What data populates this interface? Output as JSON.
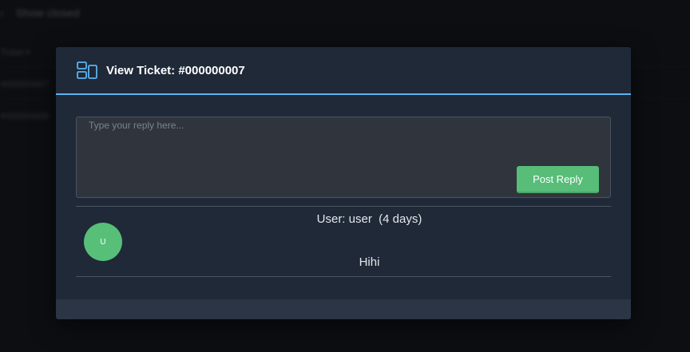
{
  "background": {
    "back_label": "Show closed",
    "rows": [
      "Ticket #",
      "#000000007",
      "#000000008"
    ]
  },
  "modal": {
    "title": "View Ticket: #000000007",
    "reply": {
      "placeholder": "Type your reply here...",
      "value": ""
    },
    "post_reply_label": "Post Reply",
    "messages": [
      {
        "avatar_initial": "U",
        "author": "User: user",
        "time": "(4 days)",
        "body": "Hihi"
      }
    ]
  },
  "colors": {
    "accent": "#5ab4f0",
    "button": "#57bd78",
    "avatar": "#58bf78",
    "modal_bg": "#1f2938"
  },
  "icons": [
    "back-arrow-icon",
    "ticket-layout-icon"
  ]
}
